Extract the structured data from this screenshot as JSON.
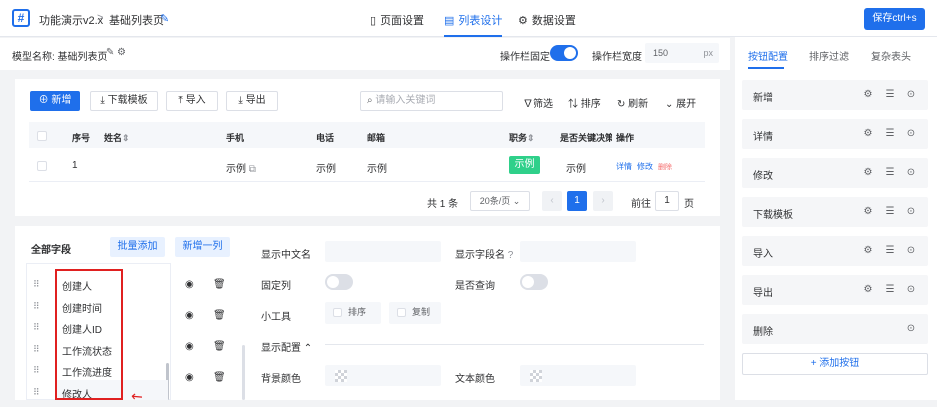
{
  "header": {
    "app_title": "功能演示v2.x",
    "breadcrumb_sep": ">",
    "page_name": "基础列表页",
    "tabs": [
      {
        "label": "页面设置",
        "active": false
      },
      {
        "label": "列表设计",
        "active": true
      },
      {
        "label": "数据设置",
        "active": false
      }
    ],
    "save_label": "保存ctrl+s"
  },
  "settings_bar": {
    "model_label": "模型名称: 基础列表页",
    "fixed_label": "操作栏固定",
    "fixed_on": true,
    "width_label": "操作栏宽度",
    "width_value": "150",
    "width_unit": "px"
  },
  "toolbar": {
    "add": "新增",
    "download_template": "下载模板",
    "import": "导入",
    "export": "导出",
    "search_placeholder": "请输入关键词",
    "filter": "筛选",
    "sort": "排序",
    "refresh": "刷新",
    "expand": "展开"
  },
  "table": {
    "headers": [
      "序号",
      "姓名",
      "手机",
      "电话",
      "邮箱",
      "职务",
      "是否关键决策",
      "操作"
    ],
    "row": {
      "index": "1",
      "name": "",
      "phone": "示例",
      "tel": "示例",
      "email": "示例",
      "position": "示例",
      "key_decision": "示例",
      "actions": [
        "详情",
        "修改",
        "删除"
      ]
    }
  },
  "pagination": {
    "total": "共 1 条",
    "page_size": "20条/页",
    "current": "1",
    "goto_label": "前往",
    "goto_value": "1",
    "page_unit": "页"
  },
  "fields": {
    "title": "全部字段",
    "batch_add": "批量添加",
    "add_column": "新增一列",
    "items": [
      "创建人",
      "创建时间",
      "创建人ID",
      "工作流状态",
      "工作流进度",
      "修改人"
    ]
  },
  "field_config": {
    "display_name_label": "显示中文名",
    "field_name_label": "显示字段名",
    "fixed_col_label": "固定列",
    "query_label": "是否查询",
    "tools_label": "小工具",
    "tool_sort": "排序",
    "tool_copy": "复制",
    "display_config_label": "显示配置",
    "bg_color_label": "背景颜色",
    "text_color_label": "文本颜色"
  },
  "right_panel": {
    "tabs": [
      {
        "label": "按钮配置",
        "active": true
      },
      {
        "label": "排序过滤",
        "active": false
      },
      {
        "label": "复杂表头",
        "active": false
      }
    ],
    "buttons": [
      "新增",
      "详情",
      "修改",
      "下载模板",
      "导入",
      "导出",
      "删除"
    ],
    "add_button": "+ 添加按钮"
  },
  "colors": {
    "primary": "#1f6feb",
    "success": "#2fd08a",
    "danger": "#f56c6c",
    "highlight_box": "#e02020"
  }
}
